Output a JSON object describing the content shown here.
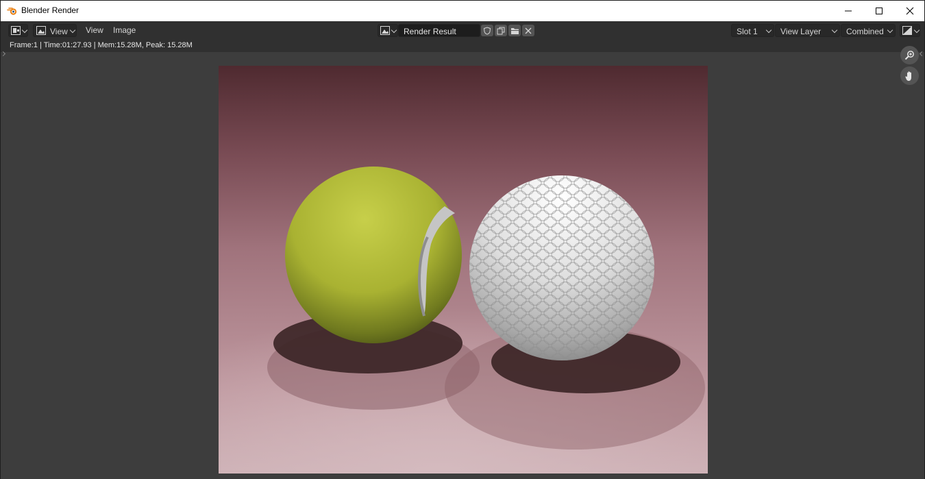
{
  "window": {
    "title": "Blender Render",
    "controls": {
      "minimize_icon": "minimize-icon",
      "maximize_icon": "maximize-icon",
      "close_icon": "close-icon"
    }
  },
  "header": {
    "editor_type_icon": "image-editor-icon",
    "view_dropdown": "View",
    "menus": [
      "View",
      "Image"
    ],
    "image_browse_icon": "image-browse-icon",
    "image_name": "Render Result",
    "slot": "Slot 1",
    "view_layer": "View Layer",
    "pass": "Combined",
    "display_mode_icon": "display-channels-icon"
  },
  "info": {
    "text": "Frame:1 | Time:01:27.93 | Mem:15.28M, Peak: 15.28M"
  },
  "colors": {
    "titlebar_bg": "#ffffff",
    "header_bg": "#303030",
    "viewport_bg": "#3d3d3d",
    "render_backdrop": "#b98c95",
    "tennis_ball": "#b8c23a",
    "golf_ball": "#e6e6e6"
  }
}
